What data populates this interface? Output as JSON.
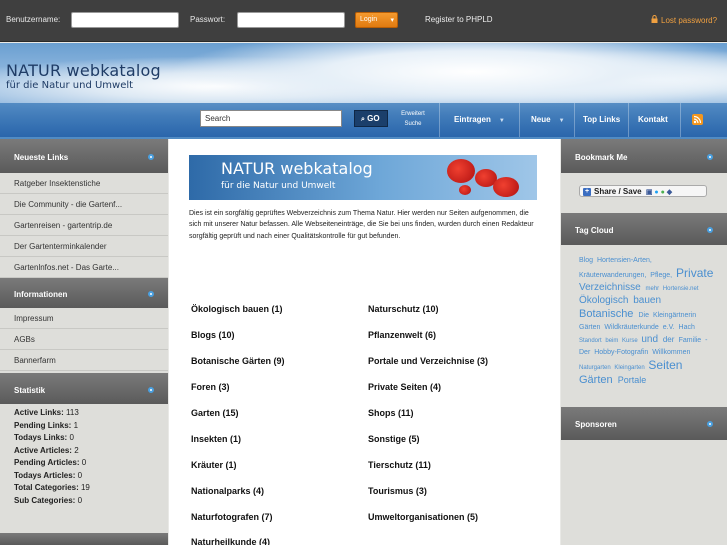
{
  "login": {
    "username_label": "Benutzername:",
    "password_label": "Passwort:",
    "username_value": "",
    "password_value": "",
    "login_button": "Login",
    "register_link": "Register to PHPLD",
    "lost_password_link": "Lost password?"
  },
  "header": {
    "logo_line1": "NATUR webkatalog",
    "logo_line2": "für die Natur und Umwelt"
  },
  "nav": {
    "search_value": "Search",
    "go_button": "GO",
    "advanced_line1": "Erweitert",
    "advanced_line2": "Suche",
    "items": [
      "Eintragen",
      "Neue",
      "Top Links",
      "Kontakt"
    ]
  },
  "left": {
    "newest_title": "Neueste Links",
    "newest_links": [
      "Ratgeber Insektenstiche",
      "Die Community - die Gartenf...",
      "Gartenreisen - gartentrip.de",
      "Der Gartenterminkalender",
      "Gartenlnfos.net - Das Garte..."
    ],
    "info_title": "Informationen",
    "info_links": [
      "Impressum",
      "AGBs",
      "Bannerfarm"
    ],
    "stats_title": "Statistik",
    "stats": [
      {
        "label": "Active Links:",
        "value": "113"
      },
      {
        "label": "Pending Links:",
        "value": "1"
      },
      {
        "label": "Todays Links:",
        "value": "0"
      },
      {
        "label": "Active Articles:",
        "value": "2"
      },
      {
        "label": "Pending Articles:",
        "value": "0"
      },
      {
        "label": "Todays Articles:",
        "value": "0"
      },
      {
        "label": "Total Categories:",
        "value": "19"
      },
      {
        "label": "Sub Categories:",
        "value": "0"
      }
    ]
  },
  "main": {
    "banner_line1": "NATUR webkatalog",
    "banner_line2": "für die Natur und Umwelt",
    "intro": "Dies ist ein sorgfältig geprüftes Webverzeichnis zum Thema Natur. Hier werden nur Seiten aufgenommen, die sich mit unserer Natur befassen. Alle Webseiteneinträge, die Sie bei uns finden, wurden durch einen Redakteur sorgfältig geprüft und nach einer Qualitätskontrolle für gut befunden.",
    "categories_left": [
      "Ökologisch bauen (1)",
      "Blogs (10)",
      "Botanische Gärten (9)",
      "Foren (3)",
      "Garten (15)",
      "Insekten (1)",
      "Kräuter (1)",
      "Nationalparks (4)",
      "Naturfotografen (7)",
      "Naturheilkunde (4)"
    ],
    "categories_right": [
      "Naturschutz (10)",
      "Pflanzenwelt (6)",
      "Portale und Verzeichnise (3)",
      "Private Seiten (4)",
      "Shops (11)",
      "Sonstige (5)",
      "Tierschutz (11)",
      "Tourismus (3)",
      "Umweltorganisationen (5)"
    ]
  },
  "right": {
    "bookmark_title": "Bookmark Me",
    "share_label": "Share / Save",
    "tagcloud_title": "Tag Cloud",
    "tags": [
      {
        "text": "Blog",
        "size": 7
      },
      {
        "text": "Hortensien-Arten,",
        "size": 7
      },
      {
        "text": "Kräuterwanderungen,",
        "size": 7
      },
      {
        "text": "Pflege,",
        "size": 7
      },
      {
        "text": "Private",
        "size": 12
      },
      {
        "text": "Verzeichnisse",
        "size": 10
      },
      {
        "text": "mehr",
        "size": 6
      },
      {
        "text": "Hortensie.net",
        "size": 6
      },
      {
        "text": "Ökologisch",
        "size": 10
      },
      {
        "text": "bauen",
        "size": 10
      },
      {
        "text": "Botanische",
        "size": 11
      },
      {
        "text": "Die",
        "size": 7
      },
      {
        "text": "Kleingärtnerin",
        "size": 7
      },
      {
        "text": "Gärten",
        "size": 7
      },
      {
        "text": "Wildkräuterkunde",
        "size": 7
      },
      {
        "text": "e.V.",
        "size": 7
      },
      {
        "text": "Hach",
        "size": 7
      },
      {
        "text": "Standort",
        "size": 6
      },
      {
        "text": "beim",
        "size": 6
      },
      {
        "text": "Kurse",
        "size": 6
      },
      {
        "text": "und",
        "size": 10
      },
      {
        "text": "der",
        "size": 8
      },
      {
        "text": "Familie",
        "size": 7
      },
      {
        "text": "-",
        "size": 7
      },
      {
        "text": "Der",
        "size": 7
      },
      {
        "text": "Hobby-Fotografin",
        "size": 7
      },
      {
        "text": "Willkommen",
        "size": 7
      },
      {
        "text": "Naturgarten",
        "size": 6
      },
      {
        "text": "Kleingarten",
        "size": 6
      },
      {
        "text": "Seiten",
        "size": 12
      },
      {
        "text": "Gärten",
        "size": 11
      },
      {
        "text": "Portale",
        "size": 9
      }
    ],
    "sponsors_title": "Sponsoren"
  },
  "colors": {
    "accent_orange": "#e07a10",
    "header_blue": "#4f8ac3",
    "sidebar_head": "#5a5a5a",
    "tag_blue": "#4a8fd0"
  }
}
